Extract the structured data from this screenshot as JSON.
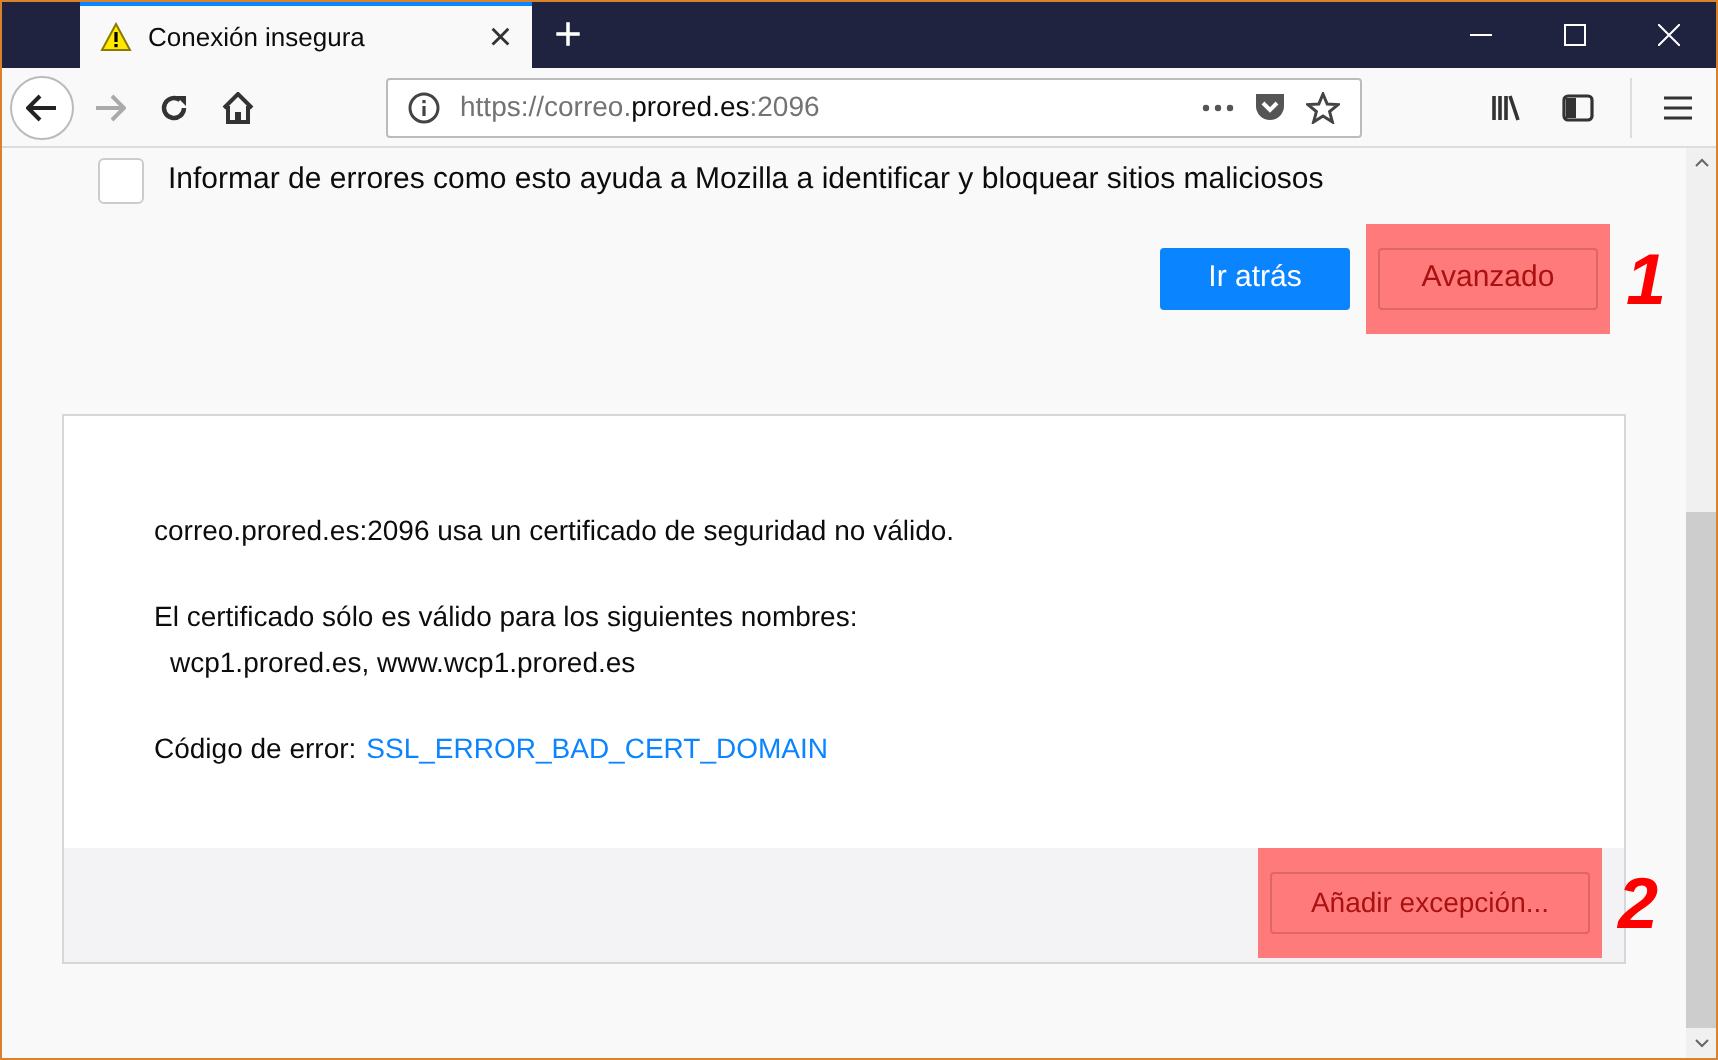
{
  "tab": {
    "title": "Conexión insegura",
    "close": "×",
    "new_tab": "+"
  },
  "url": {
    "prefix": "https://correo.",
    "domain": "prored.es",
    "suffix": ":2096"
  },
  "report": {
    "label": "Informar de errores como esto ayuda a Mozilla a identificar y bloquear sitios maliciosos",
    "checked": false
  },
  "buttons": [
    {
      "label": "Ir atrás",
      "kind": "primary"
    },
    {
      "label": "Avanzado",
      "kind": "highlighted",
      "marker": "1"
    }
  ],
  "details": {
    "message": "correo.prored.es:2096 usa un certificado de seguridad no válido.",
    "names_intro": "El certificado sólo es válido para los siguientes nombres:",
    "names": "wcp1.prored.es, www.wcp1.prored.es",
    "error_label": "Código de error:",
    "error_code": "SSL_ERROR_BAD_CERT_DOMAIN",
    "exception_button": {
      "label": "Añadir excepción...",
      "marker": "2"
    }
  }
}
